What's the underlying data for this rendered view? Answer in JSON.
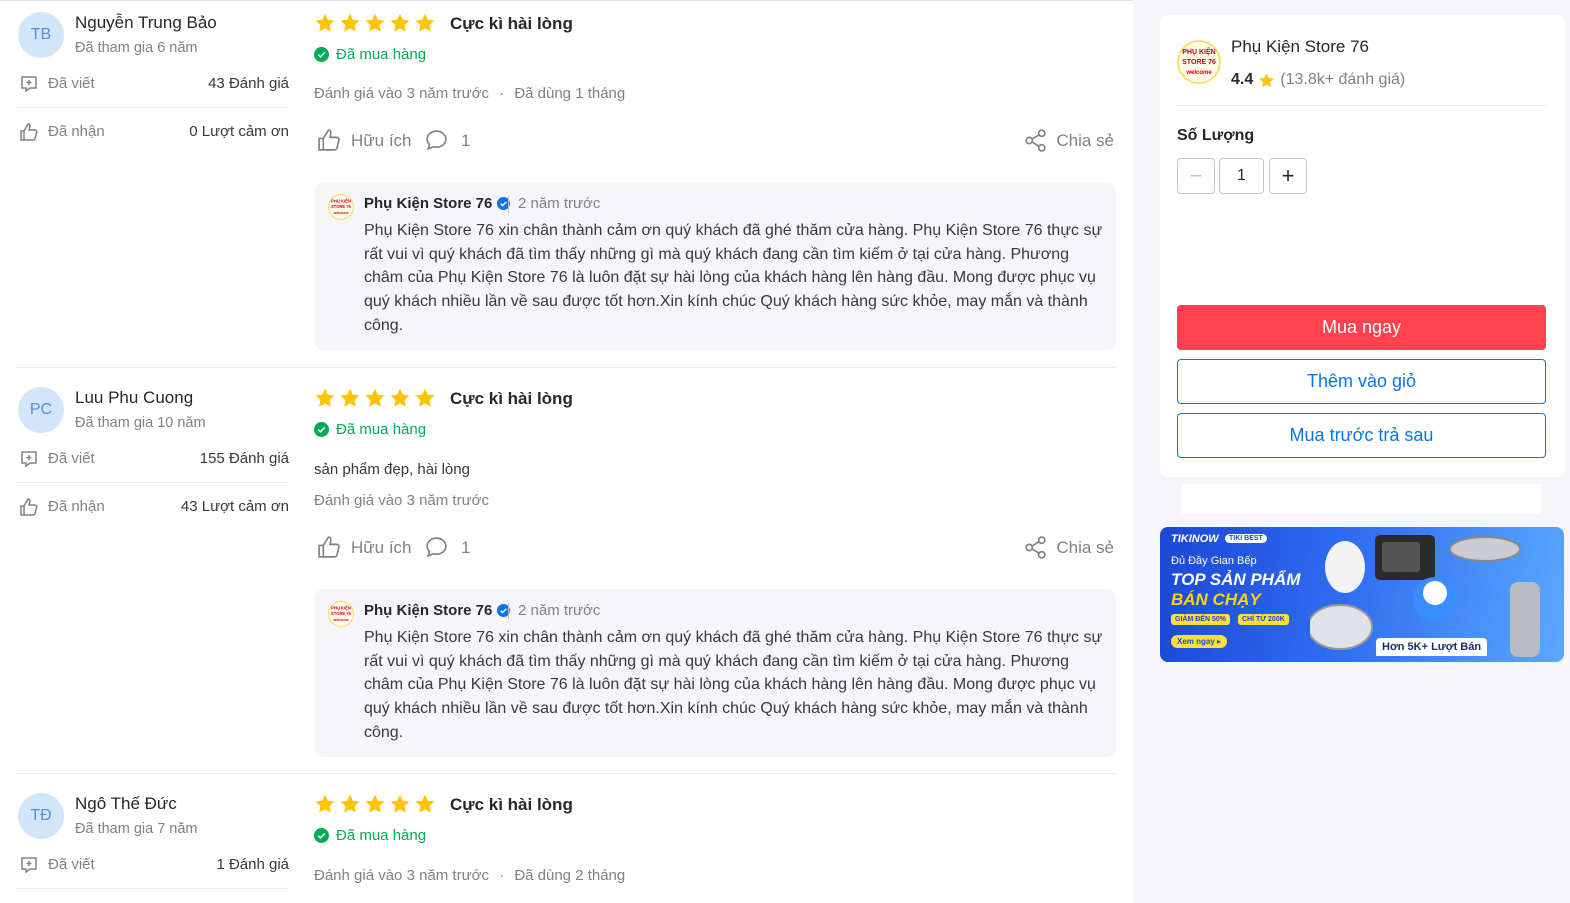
{
  "reviews": [
    {
      "initials": "TB",
      "name": "Nguyễn Trung Bảo",
      "joined": "Đã tham gia 6 năm",
      "written_label": "Đã viết",
      "written_value": "43 Đánh giá",
      "received_label": "Đã nhận",
      "received_value": "0 Lượt cảm ơn",
      "stars": 5,
      "title": "Cực kì hài lòng",
      "bought": "Đã mua hàng",
      "text": "",
      "reviewed_at": "Đánh giá vào 3 năm trước",
      "used_for": "Đã dùng 1 tháng",
      "helpful": "Hữu ích",
      "comments": "1",
      "share": "Chia sẻ",
      "reply": {
        "shop": "Phụ Kiện Store 76",
        "time": "2 năm trước",
        "text": "Phụ Kiện Store 76 xin chân thành cảm ơn quý khách đã ghé thăm cửa hàng. Phụ Kiện Store 76 thực sự rất vui vì quý khách đã tìm thấy những gì mà quý khách đang cần tìm kiếm ở tại cửa hàng. Phương châm của Phụ Kiện Store 76 là luôn đặt sự hài lòng của khách hàng lên hàng đầu. Mong được phục vụ quý khách nhiều lần về sau được tốt hơn.Xin kính chúc Quý khách hàng sức khỏe, may mắn và thành công."
      }
    },
    {
      "initials": "PC",
      "name": "Luu Phu Cuong",
      "joined": "Đã tham gia 10 năm",
      "written_label": "Đã viết",
      "written_value": "155 Đánh giá",
      "received_label": "Đã nhận",
      "received_value": "43 Lượt cảm ơn",
      "stars": 5,
      "title": "Cực kì hài lòng",
      "bought": "Đã mua hàng",
      "text": "sản phẩm đẹp, hài lòng",
      "reviewed_at": "Đánh giá vào 3 năm trước",
      "used_for": "",
      "helpful": "Hữu ích",
      "comments": "1",
      "share": "Chia sẻ",
      "reply": {
        "shop": "Phụ Kiện Store 76",
        "time": "2 năm trước",
        "text": "Phụ Kiện Store 76 xin chân thành cảm ơn quý khách đã ghé thăm cửa hàng. Phụ Kiện Store 76 thực sự rất vui vì quý khách đã tìm thấy những gì mà quý khách đang cần tìm kiếm ở tại cửa hàng. Phương châm của Phụ Kiện Store 76 là luôn đặt sự hài lòng của khách hàng lên hàng đầu. Mong được phục vụ quý khách nhiều lần về sau được tốt hơn.Xin kính chúc Quý khách hàng sức khỏe, may mắn và thành công."
      }
    },
    {
      "initials": "TĐ",
      "name": "Ngô Thế Đức",
      "joined": "Đã tham gia 7 năm",
      "written_label": "Đã viết",
      "written_value": "1 Đánh giá",
      "stars": 5,
      "title": "Cực kì hài lòng",
      "bought": "Đã mua hàng",
      "reviewed_at": "Đánh giá vào 3 năm trước",
      "used_for": "Đã dùng 2 tháng"
    }
  ],
  "meta_separator": "·",
  "shop": {
    "logo_lines": [
      "PHỤ KIỆN",
      "STORE 76",
      "welcome"
    ],
    "name": "Phụ Kiện Store 76",
    "rating": "4.4",
    "rating_count": "(13.8k+ đánh giá)"
  },
  "quantity": {
    "label": "Số Lượng",
    "minus": "−",
    "value": "1",
    "plus": "+"
  },
  "buttons": {
    "buy_now": "Mua ngay",
    "add_to_cart": "Thêm vào giỏ",
    "buy_later": "Mua trước trả sau"
  },
  "banner": {
    "brand": "TIKINOW",
    "tag": "TIKI BEST",
    "subtitle": "Đủ Đầy Gian Bếp",
    "title_line1": "TOP SẢN PHẨM",
    "title_line2": "BÁN CHẠY",
    "pill1": "GIẢM ĐẾN 50%",
    "pill2": "CHỈ TỪ 200K",
    "cta": "Xem ngay ▸",
    "sold": "Hơn 5K+ Lượt Bán"
  },
  "colors": {
    "star": "#ffc400",
    "bought_green": "#00ab56",
    "buy_red": "#ff424e",
    "link_blue": "#0b74e5",
    "verified_blue": "#0b74e5"
  }
}
